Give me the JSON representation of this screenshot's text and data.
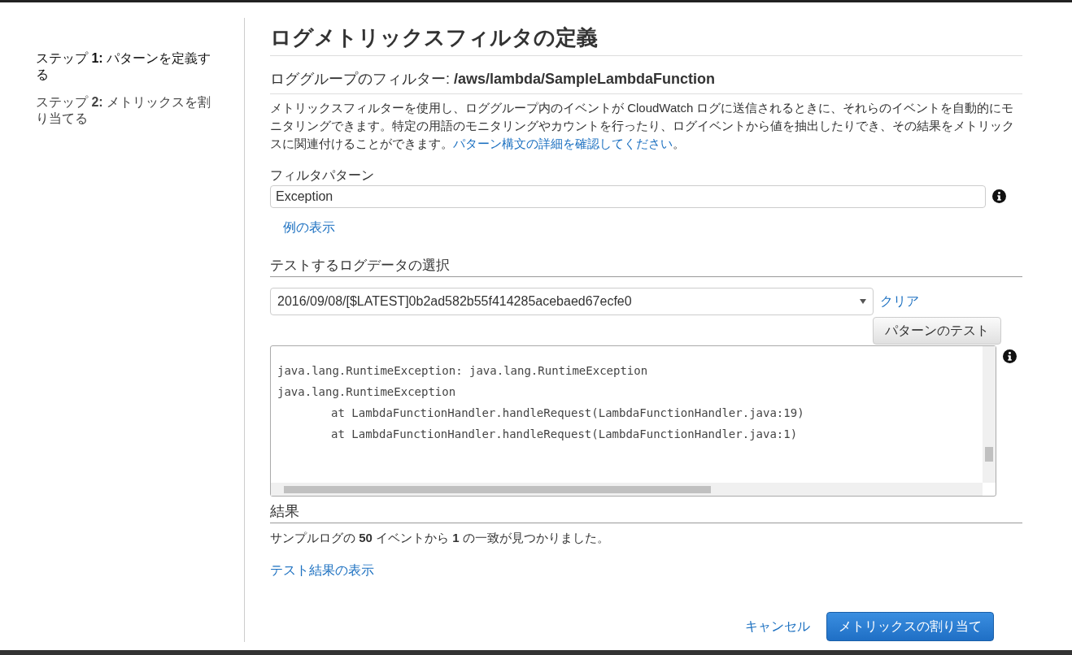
{
  "sidebar": {
    "steps": [
      {
        "label": "ステップ **1:** パターンを定義する",
        "selected": true
      },
      {
        "label": "ステップ **2:** メトリックスを割り当てる",
        "selected": false
      }
    ]
  },
  "page": {
    "title": "ログメトリックスフィルタの定義",
    "subtitle": "ロググループのフィルター: **/aws/lambda/SampleLambdaFunction**",
    "description": "メトリックスフィルターを使用し、ロググループ内のイベントが CloudWatch ログに送信されるときに、それらのイベントを自動的にモニタリングできます。特定の用語のモニタリングやカウントを行ったり、ログイベントから値を抽出したりでき、その結果をメトリックスに関連付けることができます。",
    "description_link": "パターン構文の詳細を確認してください",
    "description_end": "。"
  },
  "filter": {
    "label": "フィルタパターン",
    "value": "Exception",
    "examples_link": "例の表示"
  },
  "test": {
    "heading": "テストするログデータの選択",
    "select_value": "2016/09/08/[$LATEST]0b2ad582b55f414285acebaed67ecfe0",
    "clear_link": "クリア",
    "test_button": "パターンのテスト",
    "log_lines": [
      {
        "kind": "line",
        "text": "java.lang.RuntimeException: java.lang.RuntimeException"
      },
      {
        "kind": "line",
        "text": "java.lang.RuntimeException"
      },
      {
        "kind": "frame",
        "text": "at LambdaFunctionHandler.handleRequest(LambdaFunctionHandler.java:19)"
      },
      {
        "kind": "frame",
        "text": "at LambdaFunctionHandler.handleRequest(LambdaFunctionHandler.java:1)"
      }
    ]
  },
  "results": {
    "heading": "結果",
    "summary": "サンプルログの **50** イベントから **1** の一致が見つかりました。",
    "show_link": "テスト結果の表示"
  },
  "footer": {
    "cancel": "キャンセル",
    "submit": "メトリックスの割り当て"
  }
}
